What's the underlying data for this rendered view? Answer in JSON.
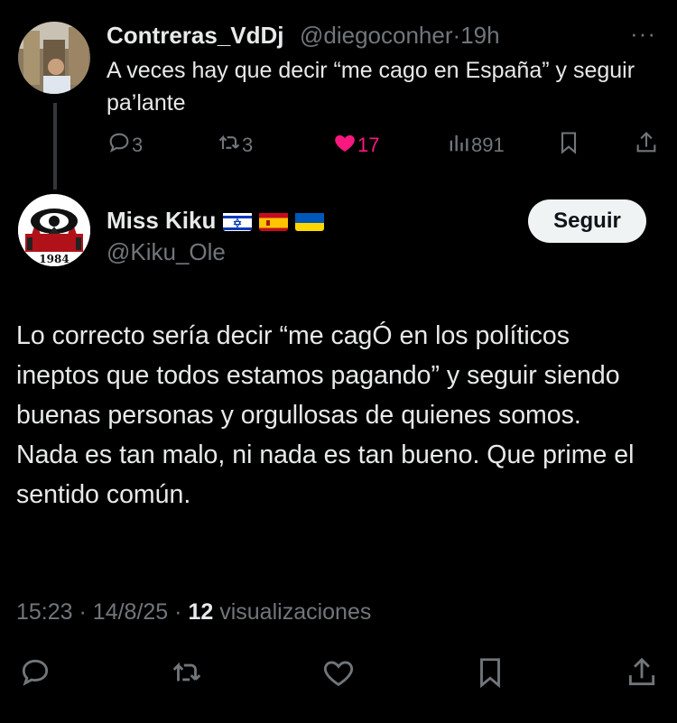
{
  "parent_tweet": {
    "display_name": "Contreras_VdDj",
    "handle": "@diegoconher",
    "separator": "·",
    "time": "19h",
    "text": "A veces hay que decir “me cago en España” y seguir pa’lante",
    "replies": "3",
    "retweets": "3",
    "likes": "17",
    "views": "891",
    "liked": true,
    "like_color": "#f91880"
  },
  "main_tweet": {
    "display_name": "Miss Kiku",
    "handle": "@Kiku_Ole",
    "flags": [
      "israel-flag-icon",
      "spain-flag-icon",
      "ukraine-flag-icon"
    ],
    "follow_label": "Seguir",
    "avatar_text": "1984",
    "text": "Lo correcto sería decir “me cagÓ en los políticos ineptos que todos estamos pagando” y seguir siendo buenas personas y orgullosas de quienes somos.\nNada es tan malo, ni nada es tan bueno. Que prime el sentido común.",
    "time": "15:23",
    "date": "14/8/25",
    "views_count": "12",
    "views_label": "visualizaciones"
  },
  "colors": {
    "background": "#000000",
    "text": "#e7e9ea",
    "muted": "#71767b",
    "like": "#f91880"
  }
}
